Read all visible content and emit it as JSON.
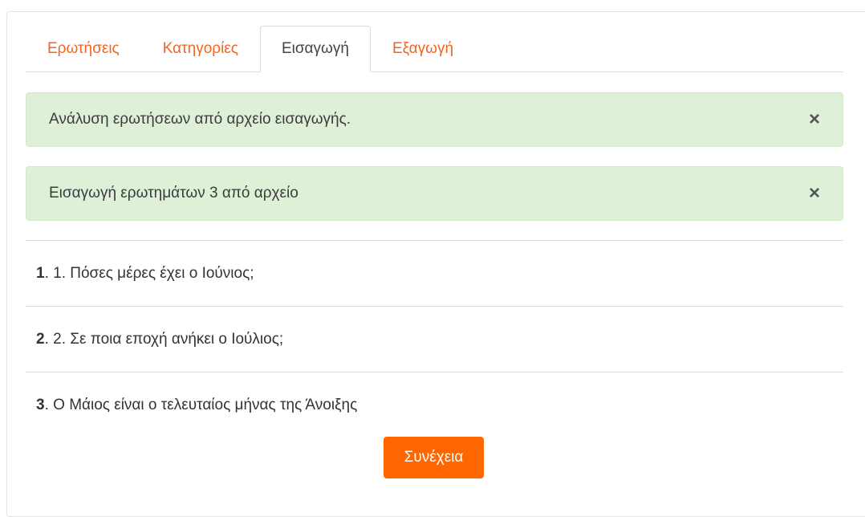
{
  "tabs": [
    {
      "label": "Ερωτήσεις",
      "active": false
    },
    {
      "label": "Κατηγορίες",
      "active": false
    },
    {
      "label": "Εισαγωγή",
      "active": true
    },
    {
      "label": "Εξαγωγή",
      "active": false
    }
  ],
  "alerts": [
    {
      "text": "Ανάλυση ερωτήσεων από αρχείο εισαγωγής.",
      "close": "×"
    },
    {
      "text": "Εισαγωγή ερωτημάτων 3 από αρχείο",
      "close": "×"
    }
  ],
  "questions": [
    {
      "number": "1",
      "text": ". 1. Πόσες μέρες έχει ο Ιούνιος;"
    },
    {
      "number": "2",
      "text": ". 2. Σε ποια εποχή ανήκει ο Ιούλιος;"
    },
    {
      "number": "3",
      "text": ". Ο Μάιος είναι ο τελευταίος μήνας της Άνοιξης"
    }
  ],
  "continue_label": "Συνέχεια",
  "colors": {
    "accent": "#ff6600",
    "tab_link": "#f26522",
    "alert_bg": "#dff0d8"
  },
  "icons": {
    "close": "close-icon"
  }
}
